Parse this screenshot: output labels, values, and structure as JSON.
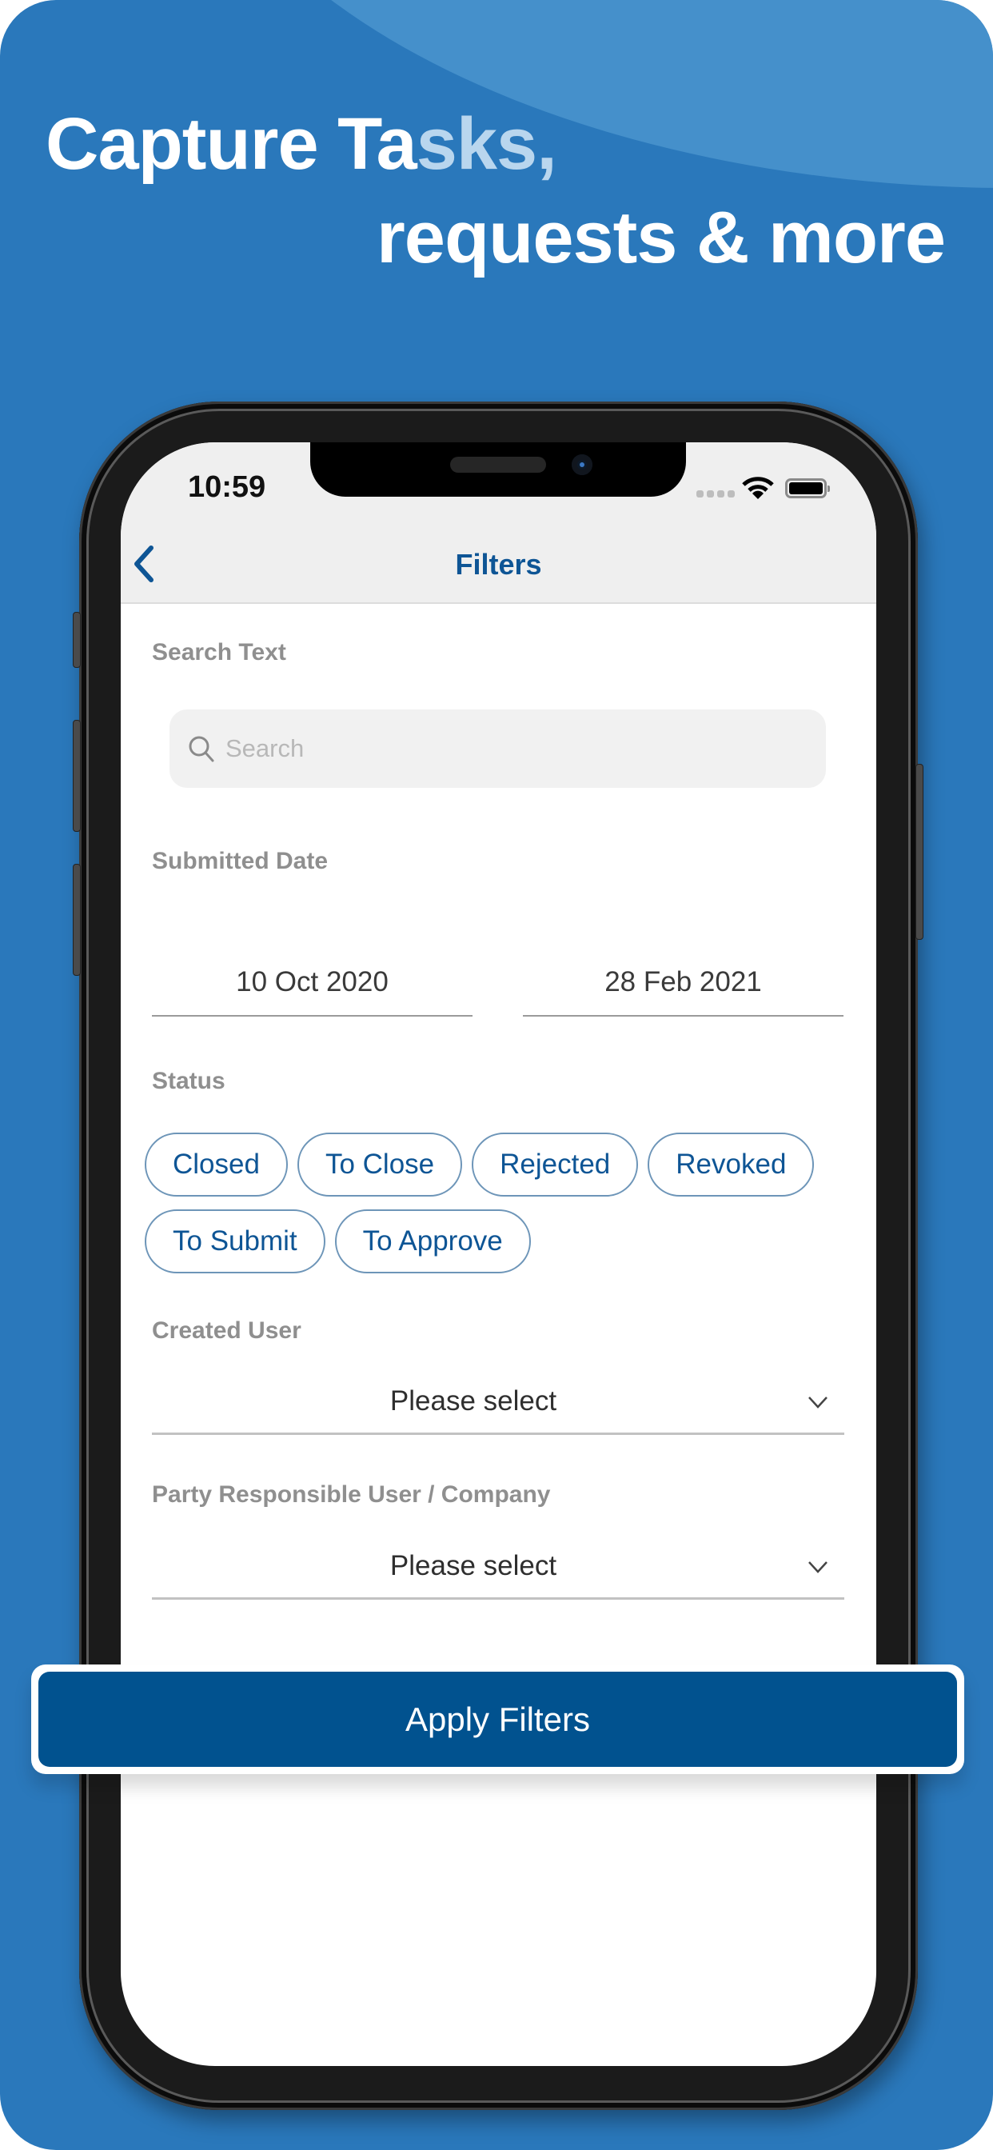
{
  "promo": {
    "headline_line1_a": "Capture Ta",
    "headline_line1_b": "sks,",
    "headline_line2": "requests & more",
    "background_color": "#2a78bb",
    "accent_color": "#01528f"
  },
  "status_bar": {
    "time": "10:59",
    "icons": [
      "cellular-signal-icon",
      "wifi-icon",
      "battery-icon"
    ]
  },
  "nav": {
    "back_icon": "chevron-left-icon",
    "title": "Filters"
  },
  "filters": {
    "search_text": {
      "label": "Search Text",
      "placeholder": "Search",
      "value": ""
    },
    "submitted_date": {
      "label": "Submitted Date",
      "from": "10 Oct 2020",
      "to": "28 Feb 2021"
    },
    "status": {
      "label": "Status",
      "options": [
        "Closed",
        "To Close",
        "Rejected",
        "Revoked",
        "To Submit",
        "To Approve"
      ]
    },
    "created_user": {
      "label": "Created User",
      "value": "Please select"
    },
    "party_responsible": {
      "label": "Party Responsible User / Company",
      "value": "Please select"
    }
  },
  "actions": {
    "apply_label": "Apply Filters"
  }
}
